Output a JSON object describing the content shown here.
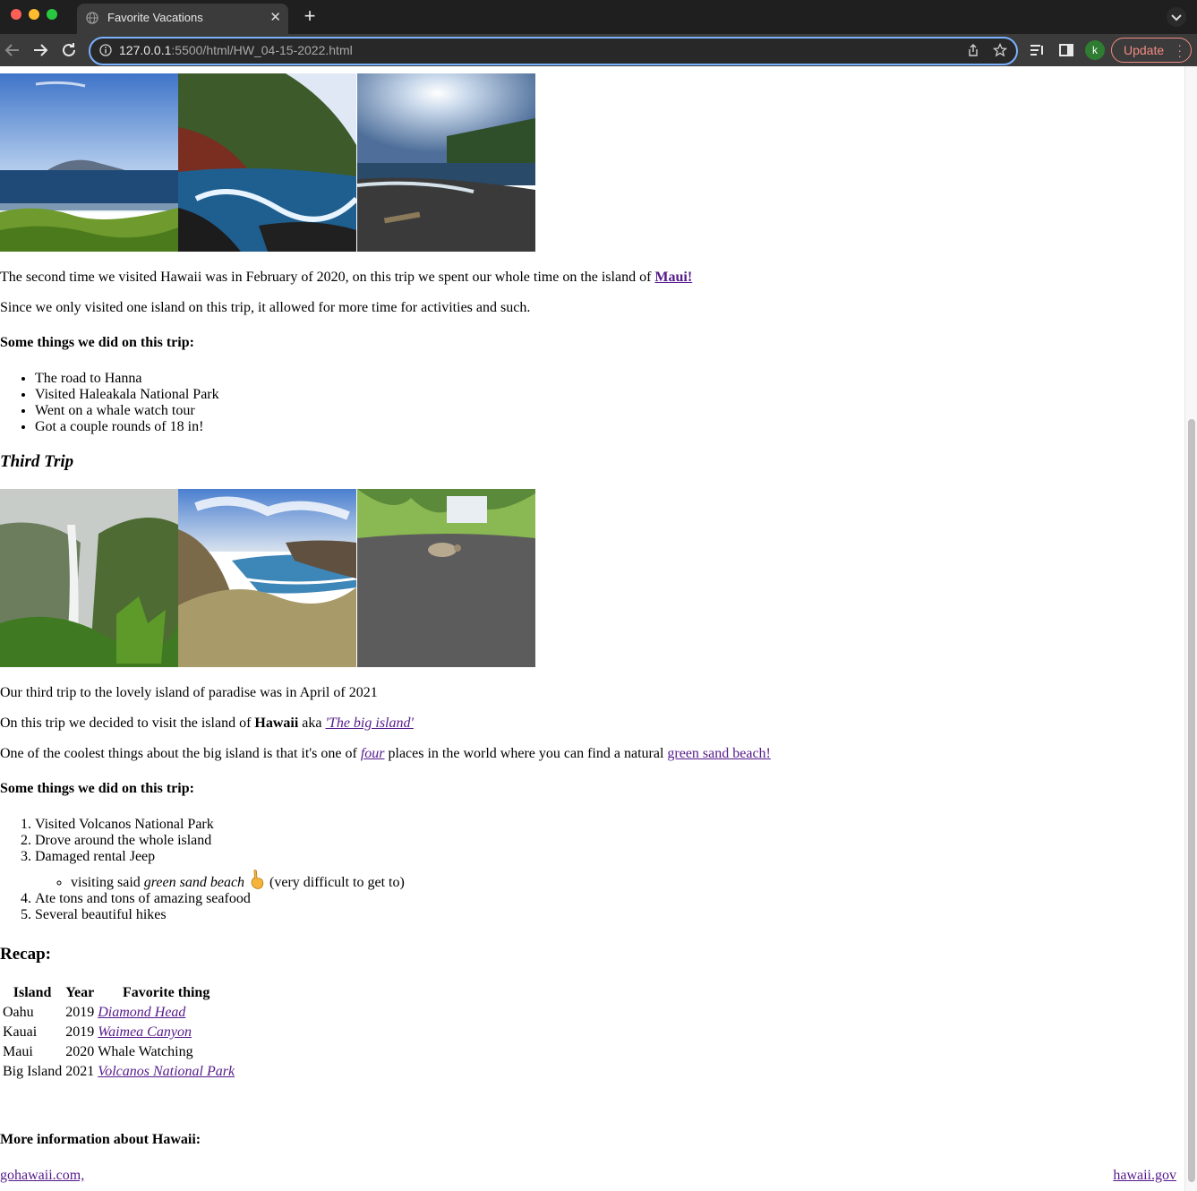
{
  "browser": {
    "tab_title": "Favorite Vacations",
    "url_host": "127.0.0.1",
    "url_path": ":5500/html/HW_04-15-2022.html",
    "avatar_letter": "k",
    "update_label": "Update"
  },
  "second_trip": {
    "line1_text": "The second time we visited Hawaii was in February of 2020, on this trip we spent our whole time on the island of ",
    "line1_link": "Maui!",
    "line2": "Since we only visited one island on this trip, it allowed for more time for activities and such.",
    "heading": "Some things we did on this trip:",
    "items": [
      "The road to Hanna",
      "Visited Haleakala National Park",
      "Went on a whale watch tour",
      "Got a couple rounds of 18 in!"
    ]
  },
  "third_trip": {
    "title": "Third Trip",
    "line1": "Our third trip to the lovely island of paradise was in April of 2021",
    "line2_a": "On this trip we decided to visit the island of ",
    "line2_bold": "Hawaii",
    "line2_b": " aka ",
    "line2_link": "'The big island'",
    "line3_a": "One of the coolest things about the big island is that it's one of ",
    "line3_link1": "four",
    "line3_b": " places in the world where you can find a natural ",
    "line3_link2": "green sand beach!",
    "heading": "Some things we did on this trip:",
    "items": [
      "Visited Volcanos National Park",
      "Drove around the whole island",
      "Damaged rental Jeep",
      "Ate tons and tons of amazing seafood",
      "Several beautiful hikes"
    ],
    "sub_item_a": "visiting said ",
    "sub_item_em": "green sand beach",
    "sub_item_b": "(very difficult to get to)"
  },
  "recap": {
    "title": "Recap:",
    "headers": [
      "Island",
      "Year",
      "Favorite thing"
    ],
    "rows": [
      {
        "island": "Oahu",
        "year": "2019",
        "favorite": "Diamond Head"
      },
      {
        "island": "Kauai",
        "year": "2019",
        "favorite": "Waimea Canyon"
      },
      {
        "island": "Maui",
        "year": "2020",
        "favorite": "Whale Watching"
      },
      {
        "island": "Big Island",
        "year": "2021",
        "favorite": "Volcanos National Park"
      }
    ]
  },
  "more_info": {
    "heading": "More information about Hawaii:",
    "link_left": "gohawaii.com,",
    "link_right": "hawaii.gov"
  }
}
